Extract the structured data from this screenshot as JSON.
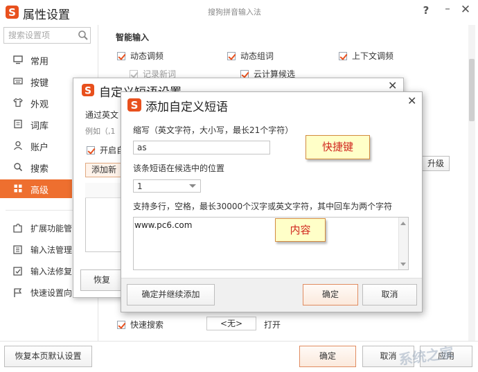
{
  "main_window": {
    "title": "属性设置",
    "app_name": "搜狗拼音输入法",
    "logo_text": "S",
    "search_placeholder": "搜索设置项",
    "nav": [
      {
        "label": "常用"
      },
      {
        "label": "按键"
      },
      {
        "label": "外观"
      },
      {
        "label": "词库"
      },
      {
        "label": "账户"
      },
      {
        "label": "搜索"
      },
      {
        "label": "高级",
        "active": true
      }
    ],
    "ext": [
      {
        "label": "扩展功能管"
      },
      {
        "label": "输入法管理"
      },
      {
        "label": "输入法修复"
      },
      {
        "label": "快速设置向"
      }
    ],
    "content": {
      "heading": "智能输入",
      "row1": [
        {
          "label": "动态调频",
          "checked": true
        },
        {
          "label": "动态组词",
          "checked": true
        },
        {
          "label": "上下文调频",
          "checked": true
        }
      ],
      "row2": [
        {
          "label": "记录新词",
          "checked": true,
          "disabled": true
        },
        {
          "label": "云计算候选",
          "checked": true
        }
      ],
      "upgrade_label": "升级",
      "quick_search_label": "快速搜索",
      "quick_search_value": "<无>",
      "quick_search_open": "打开"
    },
    "buttons": {
      "restore_default": "恢复本页默认设置",
      "ok": "确定",
      "cancel": "取消",
      "apply": "应用"
    },
    "watermark": "系统之家"
  },
  "custom_phrase_dialog": {
    "title": "自定义短语设置",
    "desc": "通过英文",
    "example": "例如（,1",
    "enable_label": "开启自",
    "add_button": "添加新",
    "restore_button": "恢复"
  },
  "add_phrase_dialog": {
    "title": "添加自定义短语",
    "abbr_label": "缩写（英文字符，大小写，最长21个字符）",
    "abbr_value": "as",
    "position_label": "该条短语在候选中的位置",
    "position_value": "1",
    "content_label": "支持多行，空格，最长30000个汉字或英文字符，其中回车为两个字符",
    "content_value": "www.pc6.com",
    "confirm_continue": "确定并继续添加",
    "ok": "确定",
    "cancel": "取消"
  },
  "annotations": {
    "shortcut_note": "快捷键",
    "content_note": "内容"
  },
  "colors": {
    "accent": "#ee6f2f",
    "logo": "#e8501d",
    "note_text": "#d0261e",
    "note_bg": "#ffffc8"
  }
}
